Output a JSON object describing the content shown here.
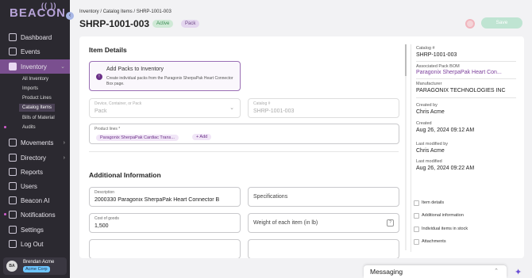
{
  "sidebar": {
    "logo": "BEACON",
    "items": [
      {
        "label": "Dashboard"
      },
      {
        "label": "Events"
      },
      {
        "label": "Inventory"
      },
      {
        "label": "Movements"
      },
      {
        "label": "Directory"
      },
      {
        "label": "Reports"
      },
      {
        "label": "Users"
      },
      {
        "label": "Beacon AI"
      },
      {
        "label": "Notifications"
      },
      {
        "label": "Settings"
      },
      {
        "label": "Log Out"
      }
    ],
    "sub_items": [
      {
        "label": "All Inventory"
      },
      {
        "label": "Imports"
      },
      {
        "label": "Product Lines"
      },
      {
        "label": "Catalog Items"
      },
      {
        "label": "Bills of Material"
      },
      {
        "label": "Audits"
      }
    ],
    "user": {
      "initials": "BA",
      "name": "Brendan Acme",
      "org": "Acme Corp"
    }
  },
  "breadcrumb": {
    "a": "Inventory",
    "sep1": "/",
    "b": "Catalog Items",
    "sep2": "/",
    "c": "SHRP-1001-003"
  },
  "header": {
    "title": "SHRP-1001-003",
    "status_badge": "Active",
    "type_badge": "Pack",
    "save_label": "Save"
  },
  "item_details": {
    "title": "Item Details",
    "notice_title": "Add Packs to Inventory",
    "notice_text": "Create individual packs from the Paragonix SherpaPak Heart Connector Box page.",
    "device_label": "Device, Container, or Pack",
    "device_value": "Pack",
    "catalog_label": "Catalog #",
    "catalog_value": "SHRP-1001-003",
    "product_lines_label": "Product lines *",
    "product_line_chip": "Paragonix SherpaPak Cardiac Trans...",
    "add_label": "+ Add"
  },
  "additional_info": {
    "title": "Additional Information",
    "description_label": "Description",
    "description_value": "2000330 Paragonix SherpaPak Heart Connector B",
    "specifications_placeholder": "Specifications",
    "cost_label": "Cost of goods",
    "cost_value": "1,500",
    "weight_placeholder": "Weight of each item (in lb)",
    "help_glyph": "?"
  },
  "meta": {
    "catalog_label": "Catalog #",
    "catalog_value": "SHRP-1001-003",
    "bom_label": "Associated Pack BOM",
    "bom_value": "Paragonix SherpaPak Heart Con...",
    "manufacturer_label": "Manufacturer",
    "manufacturer_value": "PARAGONIX TECHNOLOGIES INC",
    "created_by_label": "Created by",
    "created_by_value": "Chris Acme",
    "created_label": "Created",
    "created_value": "Aug 26, 2024 09:12 AM",
    "modified_by_label": "Last modified by",
    "modified_by_value": "Chris Acme",
    "modified_label": "Last modified",
    "modified_value": "Aug 26, 2024 09:22 AM"
  },
  "toc": [
    {
      "label": "Item details"
    },
    {
      "label": "Additional information"
    },
    {
      "label": "Individual items in stock"
    },
    {
      "label": "Attachments"
    }
  ],
  "messaging": {
    "label": "Messaging"
  },
  "colors": {
    "sidebar": "#2b2930",
    "accent": "#7a4f8f",
    "link": "#7b3e9c",
    "save": "#bfe4d2"
  }
}
